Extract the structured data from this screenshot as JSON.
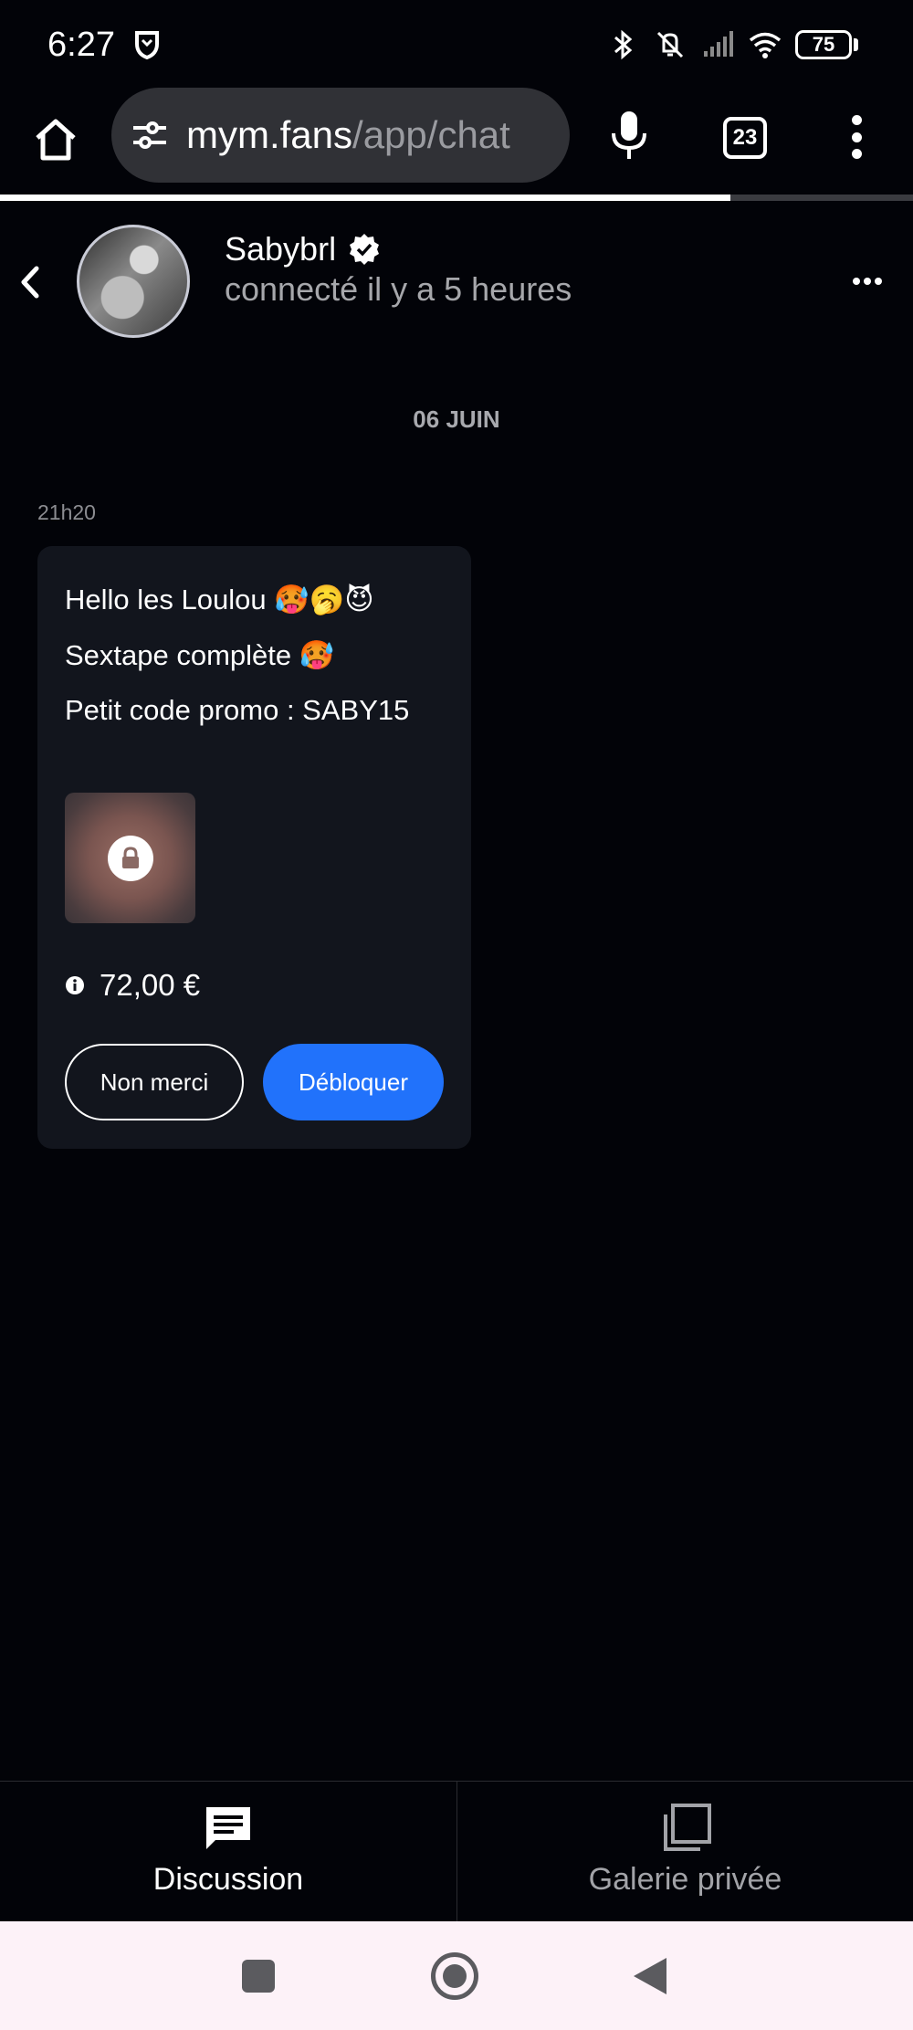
{
  "status_bar": {
    "time": "6:27",
    "battery": "75",
    "icons": [
      "shield-icon",
      "bluetooth-icon",
      "vibrate-off-icon",
      "signal-icon",
      "wifi-icon",
      "battery-icon"
    ]
  },
  "browser": {
    "url_host": "mym.fans",
    "url_path": "/app/chat",
    "tab_count": "23",
    "load_progress": 0.8
  },
  "chat_header": {
    "name": "Sabybrl",
    "status": "connecté il y a 5 heures"
  },
  "conversation": {
    "date_separator": "06 JUIN",
    "message": {
      "time": "21h20",
      "lines": [
        "Hello les Loulou 🥵🥱😈",
        "Sextape complète 🥵",
        "Petit code promo : SABY15"
      ],
      "price": "72,00 €",
      "decline_label": "Non merci",
      "unlock_label": "Débloquer"
    }
  },
  "bottom_nav": {
    "tabs": [
      {
        "label": "Discussion",
        "active": true
      },
      {
        "label": "Galerie privée",
        "active": false
      }
    ]
  },
  "colors": {
    "background": "#020308",
    "bubble": "#12151d",
    "accent": "#2172fb"
  }
}
